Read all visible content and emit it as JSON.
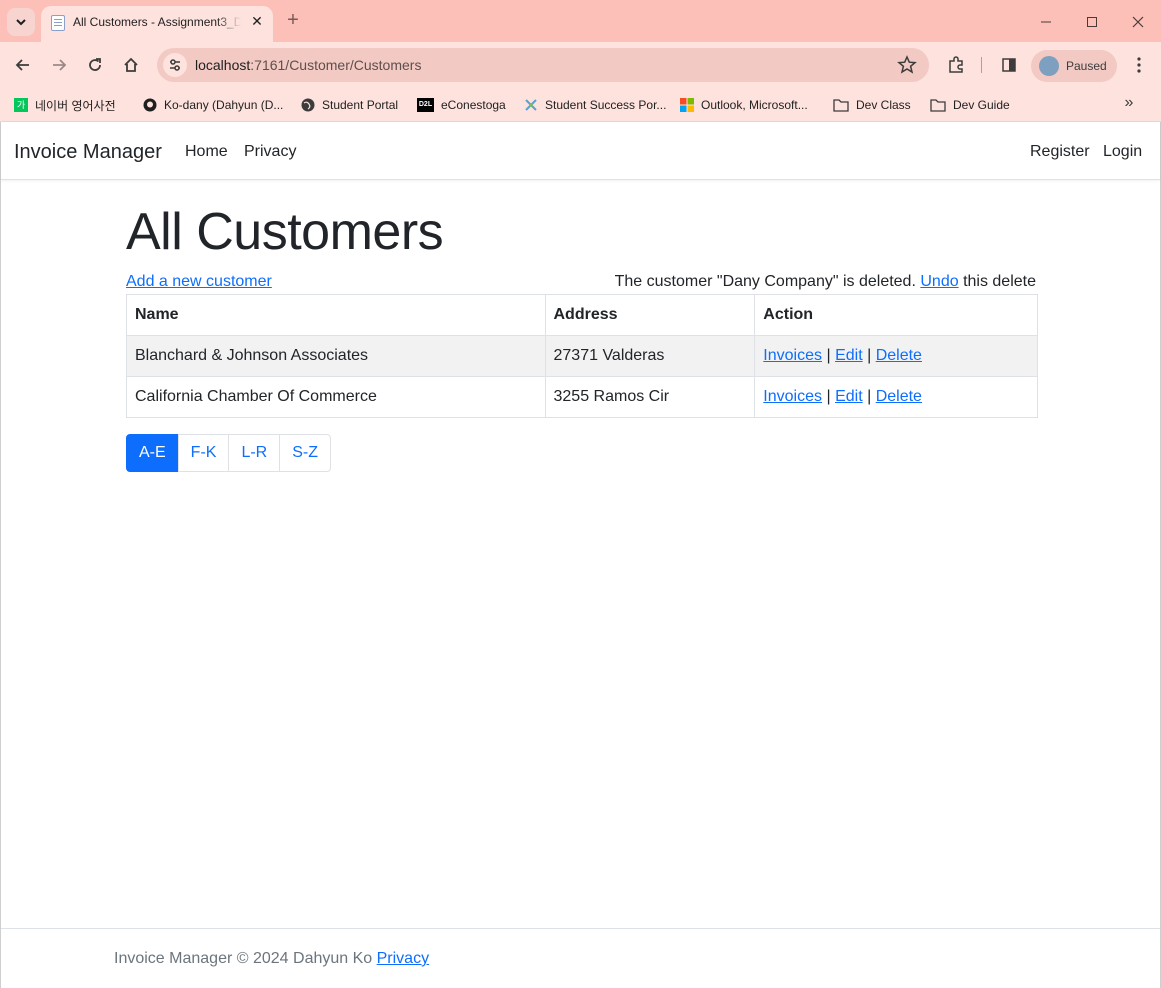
{
  "browser": {
    "tab_title": "All Customers - Assignment3_D",
    "url_host": "localhost",
    "url_rest": ":7161/Customer/Customers",
    "profile_label": "Paused",
    "bookmarks": [
      {
        "label": "네이버 영어사전",
        "icon": "naver-dictionary-icon",
        "color": "#03c75a"
      },
      {
        "label": "Ko-dany (Dahyun (D...",
        "icon": "github-icon",
        "color": "#1f1f1f"
      },
      {
        "label": "Student Portal",
        "icon": "globe-icon",
        "color": "#3c3c3c"
      },
      {
        "label": "eConestoga",
        "icon": "d2l-icon",
        "color": "#000000"
      },
      {
        "label": "Student Success Por...",
        "icon": "success-portal-icon",
        "color": "#5aa0d0"
      },
      {
        "label": "Outlook, Microsoft...",
        "icon": "microsoft-icon",
        "color": "#f25022"
      },
      {
        "label": "Dev Class",
        "icon": "folder-icon",
        "color": "#3c3c3c"
      },
      {
        "label": "Dev Guide",
        "icon": "folder-icon",
        "color": "#3c3c3c"
      }
    ]
  },
  "app": {
    "brand": "Invoice Manager",
    "nav_left": [
      "Home",
      "Privacy"
    ],
    "nav_right": [
      "Register",
      "Login"
    ]
  },
  "main": {
    "title": "All Customers",
    "add_link": "Add a new customer",
    "message_prefix": "The customer \"Dany Company\" is deleted.",
    "undo_link": "Undo",
    "message_suffix": "this delete",
    "table": {
      "headers": [
        "Name",
        "Address",
        "Action"
      ],
      "rows": [
        {
          "name": "Blanchard & Johnson Associates",
          "address": "27371 Valderas"
        },
        {
          "name": "California Chamber Of Commerce",
          "address": "3255 Ramos Cir"
        }
      ],
      "actions": [
        "Invoices",
        "Edit",
        "Delete"
      ],
      "separator": "|"
    },
    "pager": [
      "A-E",
      "F-K",
      "L-R",
      "S-Z"
    ],
    "pager_active": "A-E"
  },
  "footer": {
    "text": "Invoice Manager © 2024 Dahyun Ko",
    "privacy_link": "Privacy"
  },
  "colors": {
    "titlebar": "#fcc0b8",
    "toolbar": "#fde2de",
    "link": "#0d6efd",
    "active_pager": "#0d6efd"
  }
}
